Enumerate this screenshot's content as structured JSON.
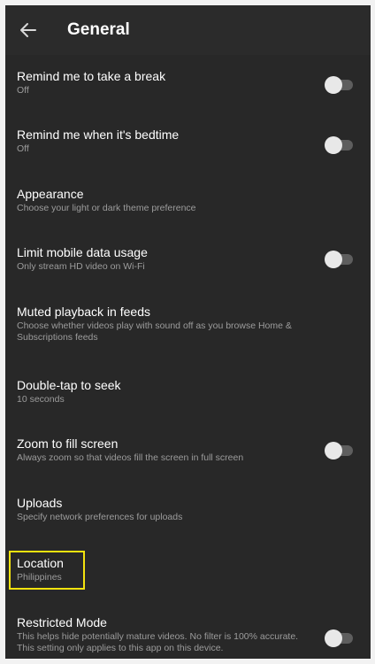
{
  "header": {
    "title": "General",
    "back_icon": "arrow-left-icon"
  },
  "settings": [
    {
      "title": "Remind me to take a break",
      "subtitle": "Off",
      "toggle": false
    },
    {
      "title": "Remind me when it's bedtime",
      "subtitle": "Off",
      "toggle": false
    },
    {
      "title": "Appearance",
      "subtitle": "Choose your light or dark theme preference"
    },
    {
      "title": "Limit mobile data usage",
      "subtitle": "Only stream HD video on Wi-Fi",
      "toggle": false
    },
    {
      "title": "Muted playback in feeds",
      "subtitle": "Choose whether videos play with sound off as you browse Home & Subscriptions feeds"
    },
    {
      "title": "Double-tap to seek",
      "subtitle": "10 seconds"
    },
    {
      "title": "Zoom to fill screen",
      "subtitle": "Always zoom so that videos fill the screen in full screen",
      "toggle": false
    },
    {
      "title": "Uploads",
      "subtitle": "Specify network preferences for uploads"
    },
    {
      "title": "Location",
      "subtitle": "Philippines",
      "highlighted": true
    },
    {
      "title": "Restricted Mode",
      "subtitle": "This helps hide potentially mature videos. No filter is 100% accurate. This setting only applies to this app on this device.",
      "toggle": false
    }
  ],
  "colors": {
    "background": "#282828",
    "highlight": "#f4e30e"
  }
}
